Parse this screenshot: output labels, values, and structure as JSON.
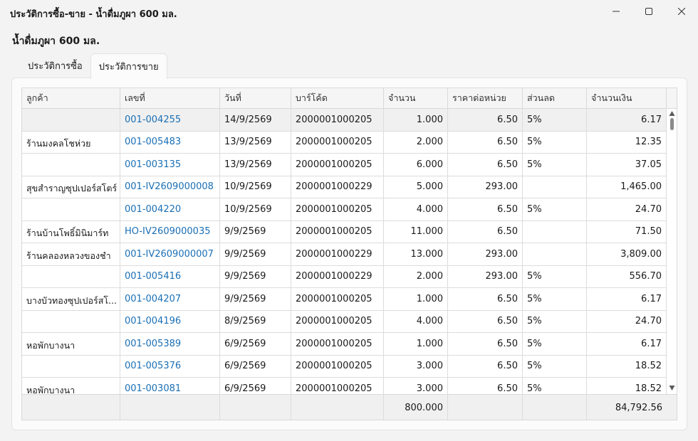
{
  "window": {
    "title": "ประวัติการซื้อ-ขาย - น้ำดื่มภูผา 600 มล.",
    "minimize_icon": "minimize-icon",
    "maximize_icon": "maximize-icon",
    "close_icon": "close-icon"
  },
  "product_title": "น้ำดื่มภูผา 600 มล.",
  "tabs": [
    {
      "label": "ประวัติการซื้อ",
      "active": false
    },
    {
      "label": "ประวัติการขาย",
      "active": true
    }
  ],
  "grid": {
    "columns": [
      "ลูกค้า",
      "เลขที่",
      "วันที่",
      "บาร์โค้ด",
      "จำนวน",
      "ราคาต่อหน่วย",
      "ส่วนลด",
      "จำนวนเงิน"
    ],
    "rows": [
      {
        "customer": "",
        "doc": "001-004255",
        "date": "14/9/2569",
        "barcode": "2000001000205",
        "qty": "1.000",
        "price": "6.50",
        "discount": "5%",
        "amount": "6.17"
      },
      {
        "customer": "ร้านมงคลโชห่วย",
        "doc": "001-005483",
        "date": "13/9/2569",
        "barcode": "2000001000205",
        "qty": "2.000",
        "price": "6.50",
        "discount": "5%",
        "amount": "12.35"
      },
      {
        "customer": "",
        "doc": "001-003135",
        "date": "13/9/2569",
        "barcode": "2000001000205",
        "qty": "6.000",
        "price": "6.50",
        "discount": "5%",
        "amount": "37.05"
      },
      {
        "customer": "สุขสำราญซุปเปอร์สโตร์",
        "doc": "001-IV2609000008",
        "date": "10/9/2569",
        "barcode": "2000001000229",
        "qty": "5.000",
        "price": "293.00",
        "discount": "",
        "amount": "1,465.00"
      },
      {
        "customer": "",
        "doc": "001-004220",
        "date": "10/9/2569",
        "barcode": "2000001000205",
        "qty": "4.000",
        "price": "6.50",
        "discount": "5%",
        "amount": "24.70"
      },
      {
        "customer": "ร้านบ้านโพธิ์มินิมาร์ท",
        "doc": "HO-IV2609000035",
        "date": "9/9/2569",
        "barcode": "2000001000205",
        "qty": "11.000",
        "price": "6.50",
        "discount": "",
        "amount": "71.50"
      },
      {
        "customer": "ร้านคลองหลวงของชำ",
        "doc": "001-IV2609000007",
        "date": "9/9/2569",
        "barcode": "2000001000229",
        "qty": "13.000",
        "price": "293.00",
        "discount": "",
        "amount": "3,809.00"
      },
      {
        "customer": "",
        "doc": "001-005416",
        "date": "9/9/2569",
        "barcode": "2000001000229",
        "qty": "2.000",
        "price": "293.00",
        "discount": "5%",
        "amount": "556.70"
      },
      {
        "customer": "บางบัวทองซุปเปอร์สโ...",
        "doc": "001-004207",
        "date": "9/9/2569",
        "barcode": "2000001000205",
        "qty": "1.000",
        "price": "6.50",
        "discount": "5%",
        "amount": "6.17"
      },
      {
        "customer": "",
        "doc": "001-004196",
        "date": "8/9/2569",
        "barcode": "2000001000205",
        "qty": "4.000",
        "price": "6.50",
        "discount": "5%",
        "amount": "24.70"
      },
      {
        "customer": "หอพักบางนา",
        "doc": "001-005389",
        "date": "6/9/2569",
        "barcode": "2000001000205",
        "qty": "1.000",
        "price": "6.50",
        "discount": "5%",
        "amount": "6.17"
      },
      {
        "customer": "",
        "doc": "001-005376",
        "date": "6/9/2569",
        "barcode": "2000001000205",
        "qty": "3.000",
        "price": "6.50",
        "discount": "5%",
        "amount": "18.52"
      },
      {
        "customer": "หอพักบางนา",
        "doc": "001-003081",
        "date": "6/9/2569",
        "barcode": "2000001000205",
        "qty": "3.000",
        "price": "6.50",
        "discount": "5%",
        "amount": "18.52"
      }
    ],
    "footer": {
      "qty_total": "800.000",
      "amount_total": "84,792.56"
    }
  },
  "colors": {
    "link": "#1a6fb5",
    "selected_row": "#f0f0f0"
  }
}
